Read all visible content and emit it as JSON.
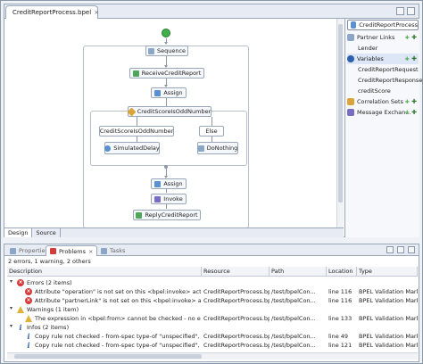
{
  "editor": {
    "tab_title": "CreditReportProcess.bpel",
    "tab_close": "×",
    "bottom_tabs": [
      "Design",
      "Source"
    ]
  },
  "palette": {
    "header": "CreditReportProcess",
    "partner_links": "Partner Links",
    "partner_items": [
      "Lender"
    ],
    "variables": "Variables",
    "variable_items": [
      "CreditReportRequest",
      "CreditReportResponse",
      "creditScore"
    ],
    "correlation_sets": "Correlation Sets",
    "message_exchanges": "Message Exchan..."
  },
  "diagram": {
    "sequence": "Sequence",
    "receive": "ReceiveCreditReport",
    "assign1": "Assign",
    "if_node": "CreditScoreIsOddNumber",
    "branch_left": "CreditScoreIsOddNumber",
    "branch_right": "Else",
    "simulated_delay": "SimulatedDelay",
    "do_nothing": "DoNothing",
    "assign2": "Assign",
    "invoke": "Invoke",
    "reply": "ReplyCreditReport"
  },
  "problems": {
    "tabs": [
      "Properties",
      "Problems",
      "Tasks"
    ],
    "active_tab": "Problems",
    "summary": "2 errors, 1 warning, 2 others",
    "columns": [
      "Description",
      "Resource",
      "Path",
      "Location",
      "Type"
    ],
    "groups": [
      {
        "label": "Errors (2 items)",
        "severity": "error",
        "rows": [
          {
            "description": "Attribute \"operation\" is not set on this <bpel:invoke> activity.",
            "resource": "CreditReportProcess.bpel",
            "path": "/test/bpelCon...",
            "location": "line 116",
            "type": "BPEL Validation Marker"
          },
          {
            "description": "Attribute \"partnerLink\" is not set on this <bpel:invoke> activity.",
            "resource": "CreditReportProcess.bpel",
            "path": "/test/bpelCon...",
            "location": "line 116",
            "type": "BPEL Validation Marker"
          }
        ]
      },
      {
        "label": "Warnings (1 item)",
        "severity": "warning",
        "rows": [
          {
            "description": "The expression in <bpel:from> cannot be checked - no expressi",
            "resource": "CreditReportProcess.bpel",
            "path": "/test/bpelCon...",
            "location": "line 133",
            "type": "BPEL Validation Marker"
          }
        ]
      },
      {
        "label": "Infos (2 items)",
        "severity": "info",
        "rows": [
          {
            "description": "Copy rule not checked - from-spec type-of \"unspecified\", to-sp",
            "resource": "CreditReportProcess.bpel",
            "path": "/test/bpelCon...",
            "location": "line 49",
            "type": "BPEL Validation Marker"
          },
          {
            "description": "Copy rule not checked - from-spec type-of \"unspecified\", to-sp",
            "resource": "CreditReportProcess.bpel",
            "path": "/test/bpelCon...",
            "location": "line 121",
            "type": "BPEL Validation Marker"
          }
        ]
      }
    ]
  },
  "colors": {
    "accent": "#5a8fd0",
    "error": "#d63b3b",
    "warning": "#e0b23a",
    "start": "#3fb04a"
  }
}
